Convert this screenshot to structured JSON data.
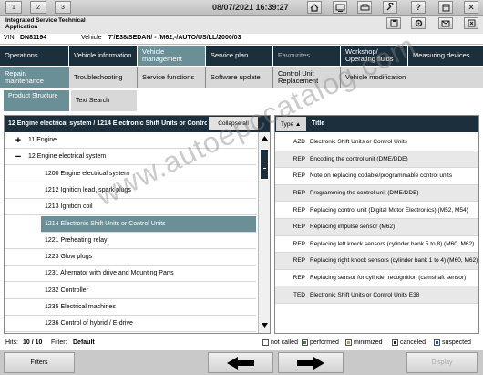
{
  "topbar": {
    "tabs": [
      "1",
      "2",
      "3"
    ],
    "datetime": "08/07/2021 16:39:27",
    "icons": [
      "home-icon",
      "screen-icon",
      "print-icon",
      "wrench-icon",
      "help-icon",
      "window-icon"
    ]
  },
  "app": {
    "title_line1": "Integrated Service Technical",
    "title_line2": "Application",
    "right_icons": [
      "save-icon",
      "settings-icon",
      "mail-icon",
      "close-icon"
    ]
  },
  "vehicle": {
    "vin_label": "VIN",
    "vin": "DN81194",
    "vehicle_label": "Vehicle",
    "vehicle_value": "7'/E38/SEDAN/ - /M62,-/AUTO/US/LL/2000/03"
  },
  "main_tabs": [
    {
      "label": "Operations",
      "state": "normal"
    },
    {
      "label": "Vehicle information",
      "state": "normal"
    },
    {
      "label": "Vehicle management",
      "state": "active"
    },
    {
      "label": "Service plan",
      "state": "normal"
    },
    {
      "label": "Favourites",
      "state": "disabled"
    },
    {
      "label": "Workshop/ Operating fluids",
      "state": "normal"
    },
    {
      "label": "Measuring devices",
      "state": "normal"
    }
  ],
  "sub_tabs": [
    {
      "label": "Repair/ maintenance",
      "state": "active"
    },
    {
      "label": "Troubleshooting",
      "state": "normal"
    },
    {
      "label": "Service functions",
      "state": "normal"
    },
    {
      "label": "Software update",
      "state": "normal"
    },
    {
      "label": "Control Unit Replacement",
      "state": "normal"
    },
    {
      "label": "Vehicle modification",
      "state": "normal"
    }
  ],
  "view_tabs": [
    {
      "label": "Product Structure",
      "state": "active"
    },
    {
      "label": "Text Search",
      "state": "normal"
    }
  ],
  "tree": {
    "header": "12 Engine electrical system / 1214 Electronic Shift Units or Control Units",
    "collapse_label": "Collapse all",
    "items": [
      {
        "toggle": "+",
        "label": "11 Engine",
        "level": 0,
        "selected": false
      },
      {
        "toggle": "−",
        "label": "12 Engine electrical system",
        "level": 0,
        "selected": false
      },
      {
        "toggle": "",
        "label": "1200 Engine electrical system",
        "level": 1,
        "selected": false
      },
      {
        "toggle": "",
        "label": "1212 Ignition lead, spark plugs",
        "level": 1,
        "selected": false
      },
      {
        "toggle": "",
        "label": "1213 Ignition coil",
        "level": 1,
        "selected": false
      },
      {
        "toggle": "",
        "label": "1214 Electronic Shift Units or Control Units",
        "level": 1,
        "selected": true
      },
      {
        "toggle": "",
        "label": "1221 Preheating relay",
        "level": 1,
        "selected": false
      },
      {
        "toggle": "",
        "label": "1223 Glow plugs",
        "level": 1,
        "selected": false
      },
      {
        "toggle": "",
        "label": "1231 Alternator with drive and Mounting Parts",
        "level": 1,
        "selected": false
      },
      {
        "toggle": "",
        "label": "1232 Controller",
        "level": 1,
        "selected": false
      },
      {
        "toggle": "",
        "label": "1235 Electrical machines",
        "level": 1,
        "selected": false
      },
      {
        "toggle": "",
        "label": "1236 Control of hybrid / E-drive",
        "level": 1,
        "selected": false
      }
    ]
  },
  "docs": {
    "col_type": "Type ▲",
    "col_title": "Title",
    "rows": [
      {
        "type": "AZD",
        "title": "Electronic Shift Units or Control Units"
      },
      {
        "type": "REP",
        "title": "Encoding the control unit (DME/DDE)"
      },
      {
        "type": "REP",
        "title": "Note on replacing codable/programmable control units"
      },
      {
        "type": "REP",
        "title": "Programming the control unit (DME/DDE)"
      },
      {
        "type": "REP",
        "title": "Replacing control unit (Digital Motor Electronics) (M52, M54)"
      },
      {
        "type": "REP",
        "title": "Replacing impulse sensor (M62)"
      },
      {
        "type": "REP",
        "title": "Replacing left knock sensors (cylinder bank 5 to 8) (M60, M62)"
      },
      {
        "type": "REP",
        "title": "Replacing right knock sensors (cylinder bank 1 to 4) (M60, M62)"
      },
      {
        "type": "REP",
        "title": "Replacing sensor for cylinder recognition (camshaft sensor)"
      },
      {
        "type": "TED",
        "title": "Electronic Shift Units or Control Units E38"
      }
    ]
  },
  "status": {
    "hits_label": "Hits:",
    "hits_value": "10 / 10",
    "filter_label": "Filter:",
    "filter_value": "Default",
    "legend": [
      {
        "label": "not called",
        "color": "#ffffff"
      },
      {
        "label": "performed",
        "color": "#3a8a3a"
      },
      {
        "label": "minimized",
        "color": "#c8a030"
      },
      {
        "label": "canceled",
        "color": "#202020"
      },
      {
        "label": "suspected",
        "color": "#3050b0"
      }
    ]
  },
  "bottom": {
    "filters_label": "Filters",
    "display_label": "Display"
  },
  "watermark": "www.autoepccatalog.com"
}
